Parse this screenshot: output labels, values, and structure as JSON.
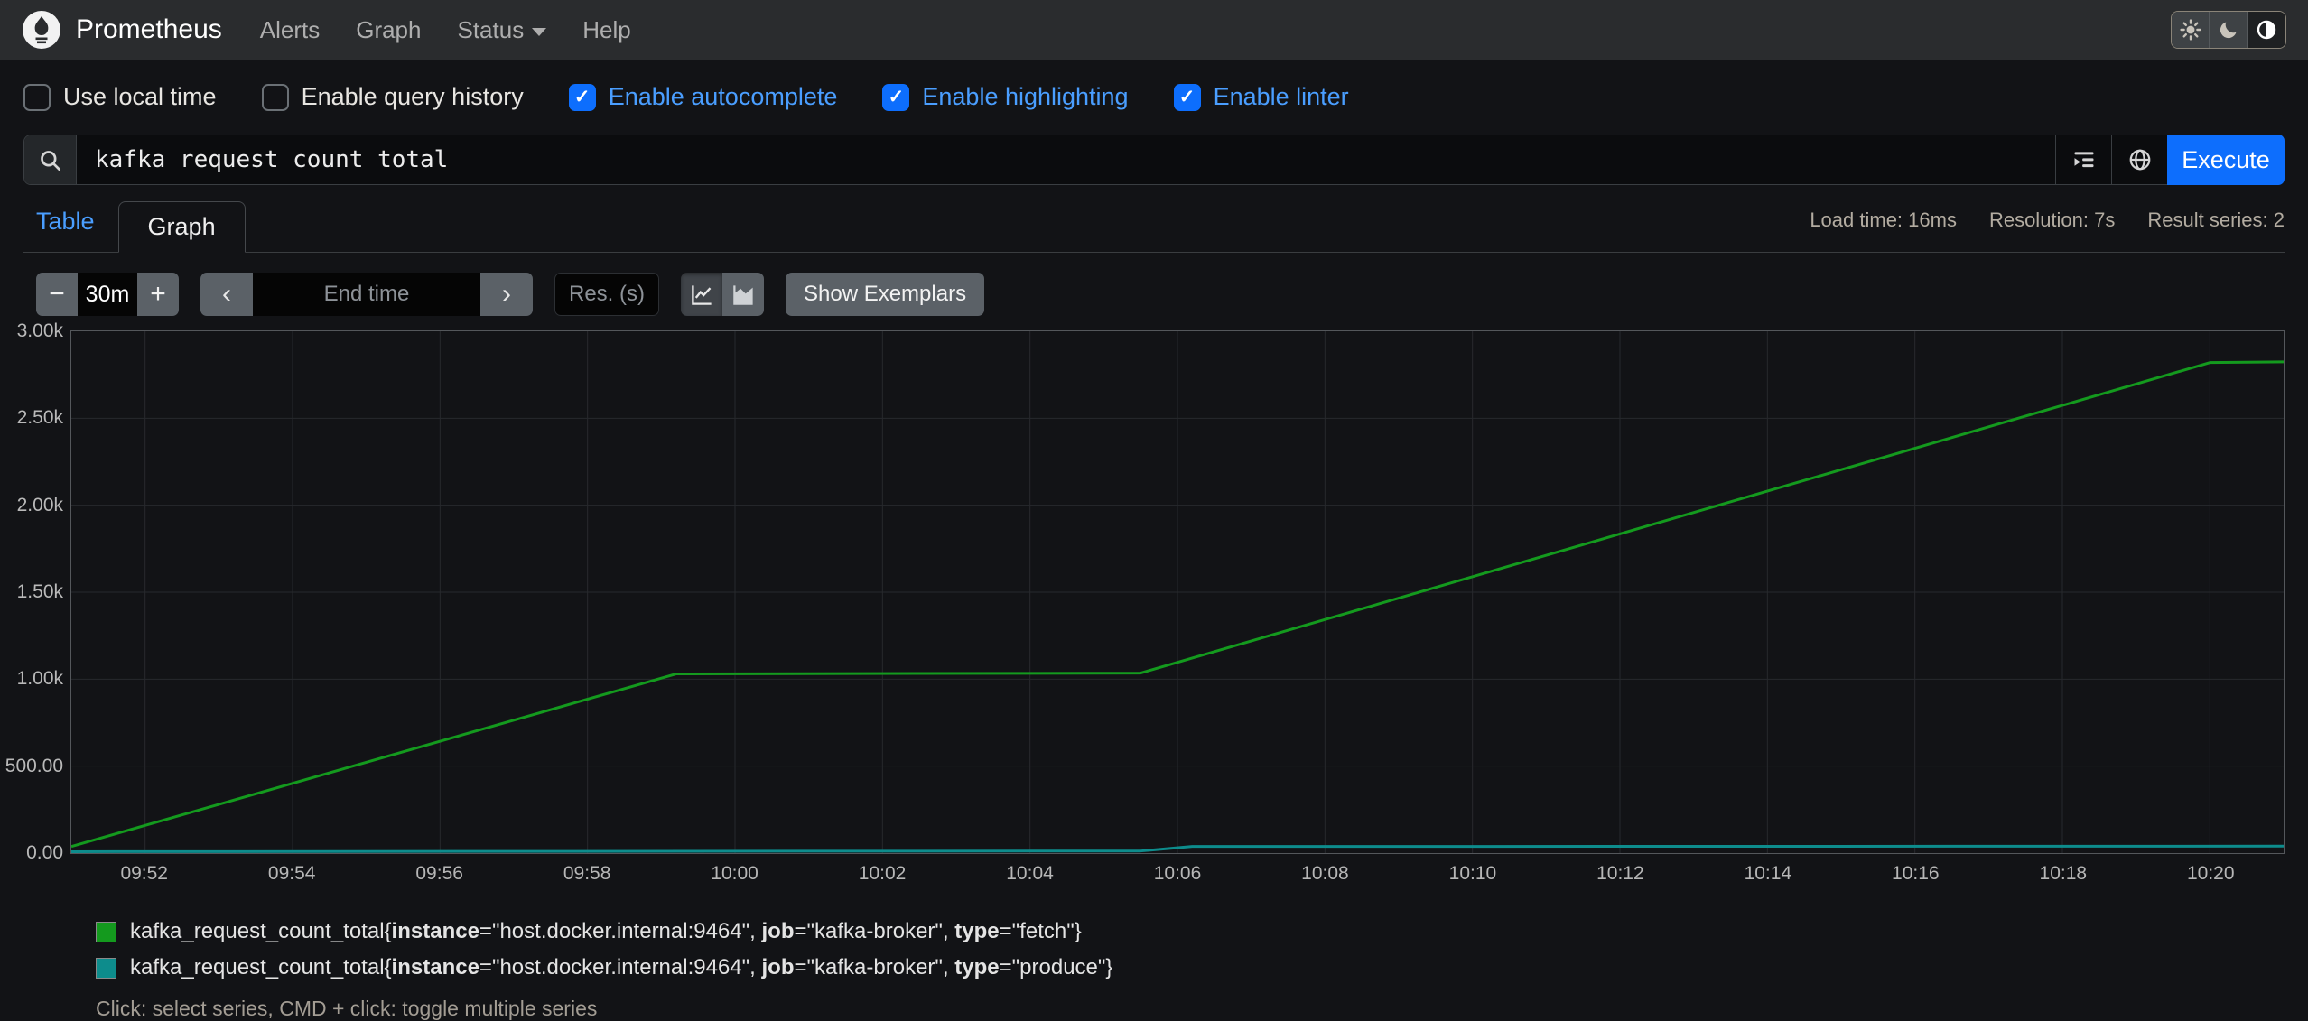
{
  "navbar": {
    "brand": "Prometheus",
    "items": [
      {
        "label": "Alerts"
      },
      {
        "label": "Graph"
      },
      {
        "label": "Status",
        "dropdown": true
      },
      {
        "label": "Help"
      }
    ],
    "theme_buttons": [
      "light",
      "dark",
      "auto"
    ],
    "active_theme": "auto"
  },
  "options": {
    "items": [
      {
        "label": "Use local time",
        "checked": false
      },
      {
        "label": "Enable query history",
        "checked": false
      },
      {
        "label": "Enable autocomplete",
        "checked": true
      },
      {
        "label": "Enable highlighting",
        "checked": true
      },
      {
        "label": "Enable linter",
        "checked": true
      }
    ]
  },
  "query": {
    "value": "kafka_request_count_total",
    "execute_label": "Execute"
  },
  "tabs": {
    "table": "Table",
    "graph": "Graph",
    "active": "Graph"
  },
  "stats": {
    "load_time": "Load time: 16ms",
    "resolution": "Resolution: 7s",
    "result_series": "Result series: 2"
  },
  "controls": {
    "minus": "−",
    "plus": "+",
    "range_value": "30m",
    "prev": "‹",
    "next": "›",
    "end_time_placeholder": "End time",
    "res_placeholder": "Res. (s)",
    "show_exemplars": "Show Exemplars"
  },
  "chart_data": {
    "type": "line",
    "title": "",
    "xlabel": "",
    "ylabel": "",
    "ylim": [
      0,
      3000
    ],
    "grid": true,
    "legend_position": "bottom-left",
    "x_total_minutes": 30,
    "x_first_tick_minute": 1,
    "x_tick_step_minutes": 2,
    "x_ticks": [
      "09:52",
      "09:54",
      "09:56",
      "09:58",
      "10:00",
      "10:02",
      "10:04",
      "10:06",
      "10:08",
      "10:10",
      "10:12",
      "10:14",
      "10:16",
      "10:18",
      "10:20"
    ],
    "y_ticks": [
      {
        "label": "0.00",
        "value": 0
      },
      {
        "label": "500.00",
        "value": 500
      },
      {
        "label": "1.00k",
        "value": 1000
      },
      {
        "label": "1.50k",
        "value": 1500
      },
      {
        "label": "2.00k",
        "value": 2000
      },
      {
        "label": "2.50k",
        "value": 2500
      },
      {
        "label": "3.00k",
        "value": 3000
      }
    ],
    "x_unit": "minutes_from_window_start",
    "series": [
      {
        "name": "kafka_request_count_total{instance=\"host.docker.internal:9464\", job=\"kafka-broker\", type=\"fetch\"}",
        "color": "#149a1e",
        "points": [
          [
            0,
            38
          ],
          [
            8.2,
            1030
          ],
          [
            14.5,
            1035
          ],
          [
            29,
            2820
          ],
          [
            30,
            2824
          ]
        ],
        "legend_parts": [
          {
            "t": "kafka_request_count_total{"
          },
          {
            "t": "instance",
            "b": true
          },
          {
            "t": "=\"host.docker.internal:9464\", "
          },
          {
            "t": "job",
            "b": true
          },
          {
            "t": "=\"kafka-broker\", "
          },
          {
            "t": "type",
            "b": true
          },
          {
            "t": "=\"fetch\"}"
          }
        ]
      },
      {
        "name": "kafka_request_count_total{instance=\"host.docker.internal:9464\", job=\"kafka-broker\", type=\"produce\"}",
        "color": "#0d8c8c",
        "points": [
          [
            0,
            8
          ],
          [
            14.5,
            12
          ],
          [
            15.2,
            38
          ],
          [
            30,
            40
          ]
        ],
        "legend_parts": [
          {
            "t": "kafka_request_count_total{"
          },
          {
            "t": "instance",
            "b": true
          },
          {
            "t": "=\"host.docker.internal:9464\", "
          },
          {
            "t": "job",
            "b": true
          },
          {
            "t": "=\"kafka-broker\", "
          },
          {
            "t": "type",
            "b": true
          },
          {
            "t": "=\"produce\"}"
          }
        ]
      }
    ]
  },
  "footer_hint": "Click: select series, CMD + click: toggle multiple series",
  "colors": {
    "accent_blue": "#0d6efd",
    "link_blue": "#4a9eff",
    "navbar_bg": "#2a2c2e",
    "page_bg": "#121316",
    "grid_line": "#27292d",
    "plot_border": "#54575b"
  }
}
